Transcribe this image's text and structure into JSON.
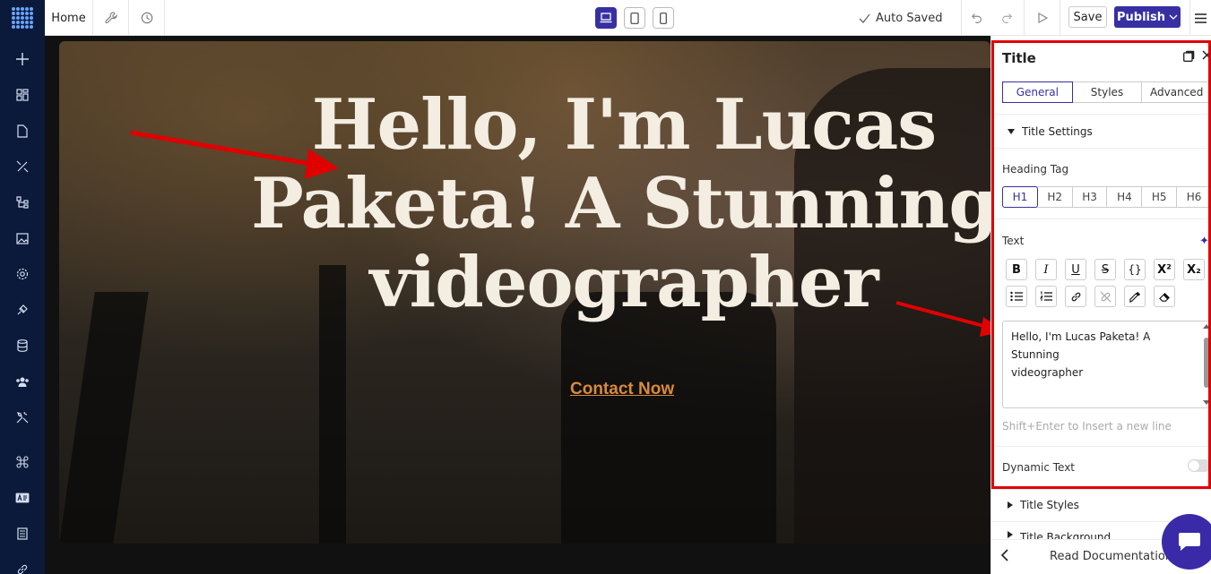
{
  "topbar": {
    "home_label": "Home",
    "autosave_label": "Auto Saved",
    "save_label": "Save",
    "publish_label": "Publish"
  },
  "hero": {
    "title_line1": "Hello, I'm Lucas",
    "title_line2": "Paketa! A Stunning",
    "title_line3": "videographer",
    "cta_label": "Contact Now"
  },
  "panel": {
    "title": "Title",
    "tabs": [
      "General",
      "Styles",
      "Advanced"
    ],
    "title_settings_label": "Title Settings",
    "heading_tag_label": "Heading Tag",
    "heading_tags": [
      "H1",
      "H2",
      "H3",
      "H4",
      "H5",
      "H6"
    ],
    "text_label": "Text",
    "text_value_line1": "Hello, I'm Lucas Paketa! A Stunning",
    "text_value_line2": "videographer",
    "hint": "Shift+Enter to Insert a new line",
    "dynamic_text_label": "Dynamic Text",
    "title_styles_label": "Title Styles",
    "title_background_label": "Title Background",
    "read_docs_label": "Read Documentation"
  },
  "colors": {
    "accent": "#3730a3",
    "sidebar": "#0b1a3a",
    "highlight": "#e00000",
    "cta": "#d98a3a"
  }
}
